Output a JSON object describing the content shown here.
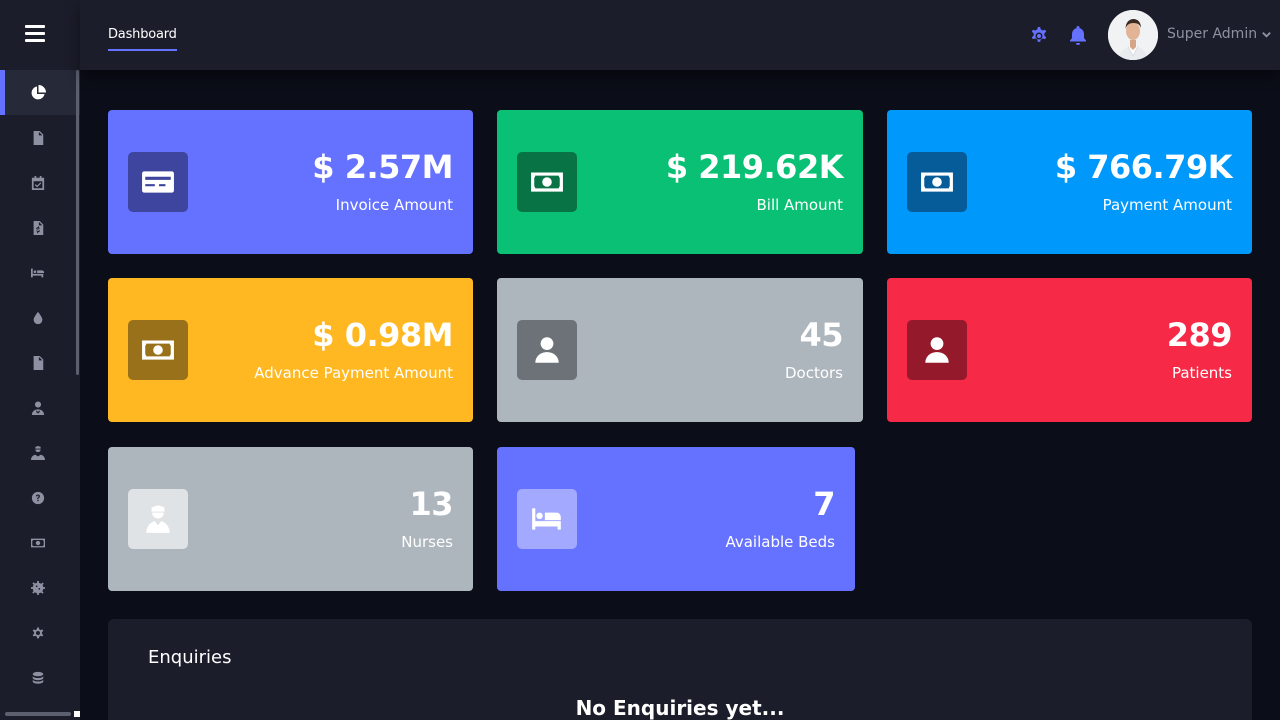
{
  "header": {
    "tab": "Dashboard",
    "user_name": "Super Admin"
  },
  "sidebar": {
    "items": [
      {
        "icon": "chart-pie-icon",
        "active": true
      },
      {
        "icon": "file-invoice-icon"
      },
      {
        "icon": "calendar-check-icon"
      },
      {
        "icon": "file-dollar-icon"
      },
      {
        "icon": "bed-icon"
      },
      {
        "icon": "blood-drop-icon"
      },
      {
        "icon": "document-icon"
      },
      {
        "icon": "user-doctor-icon"
      },
      {
        "icon": "user-nurse-icon"
      },
      {
        "icon": "question-icon"
      },
      {
        "icon": "money-icon"
      },
      {
        "icon": "vaccine-icon"
      },
      {
        "icon": "gear-icon"
      },
      {
        "icon": "coins-icon"
      }
    ]
  },
  "cards": [
    {
      "value": "$ 2.57M",
      "label": "Invoice Amount",
      "icon": "credit-card-icon",
      "color": "#6571ff",
      "icon_bg": "#3e459e"
    },
    {
      "value": "$ 219.62K",
      "label": "Bill Amount",
      "icon": "money-bill-icon",
      "color": "#0ac074",
      "icon_bg": "#087446"
    },
    {
      "value": "$ 766.79K",
      "label": "Payment Amount",
      "icon": "money-bill-icon",
      "color": "#0099fb",
      "icon_bg": "#055c98"
    },
    {
      "value": "$ 0.98M",
      "label": "Advance Payment Amount",
      "icon": "money-bill-icon",
      "color": "#ffb821",
      "icon_bg": "#99711a"
    },
    {
      "value": "45",
      "label": "Doctors",
      "icon": "user-icon",
      "color": "#adb5bd",
      "icon_bg": "#6d7278"
    },
    {
      "value": "289",
      "label": "Patients",
      "icon": "user-icon",
      "color": "#f62947",
      "icon_bg": "#94192b"
    },
    {
      "value": "13",
      "label": "Nurses",
      "icon": "user-nurse-icon",
      "color": "#adb5bd",
      "icon_bg": "#e0e3e6"
    },
    {
      "value": "7",
      "label": "Available Beds",
      "icon": "bed-icon",
      "color": "#6571ff",
      "icon_bg": "#a2a9ff"
    }
  ],
  "enquiries": {
    "title": "Enquiries",
    "empty_text": "No Enquiries yet..."
  },
  "colors": {
    "accent": "#6571ff",
    "background": "#0b0d18",
    "panel": "#1b1d2a"
  }
}
